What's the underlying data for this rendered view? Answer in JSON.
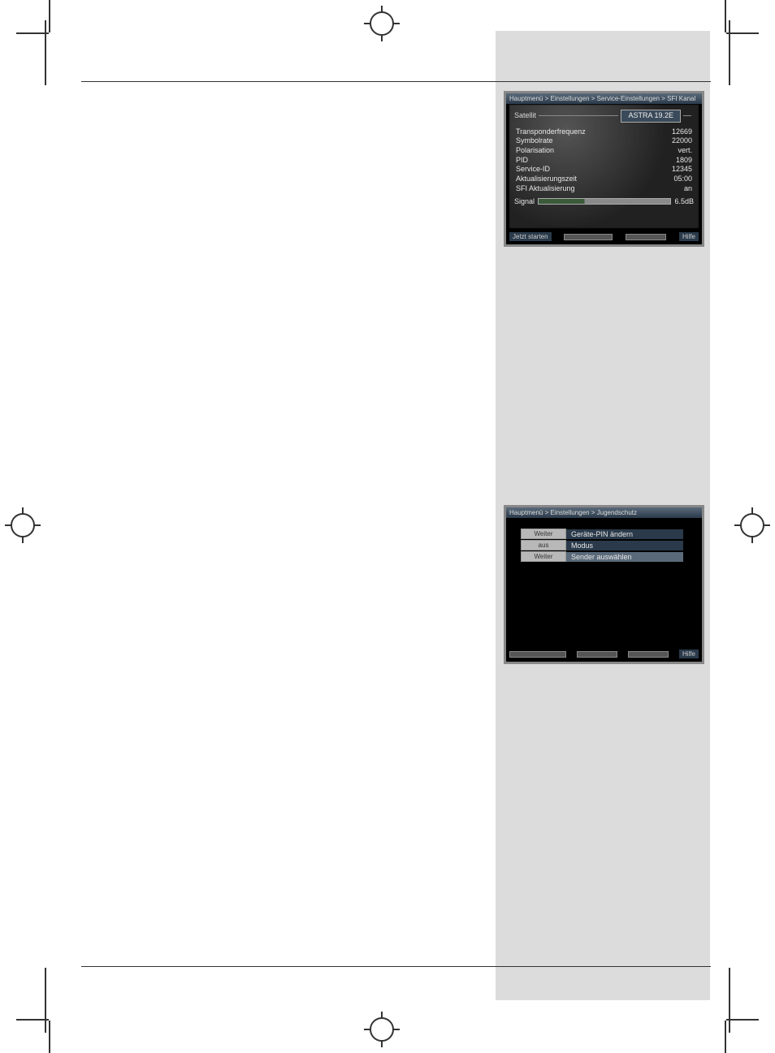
{
  "panel1": {
    "breadcrumb": "Hauptmenü > Einstellungen > Service-Einstellungen > SFI Kanal",
    "satellite_label": "Satellit",
    "satellite_value": "ASTRA 19.2E",
    "rows": [
      {
        "label": "Transponderfrequenz",
        "value": "12669"
      },
      {
        "label": "Symbolrate",
        "value": "22000"
      },
      {
        "label": "Polarisation",
        "value": "vert."
      },
      {
        "label": "PID",
        "value": "1809"
      },
      {
        "label": "Service-ID",
        "value": "12345"
      },
      {
        "label": "Aktualisierungszeit",
        "value": "05:00"
      },
      {
        "label": "SFI Aktualisierung",
        "value": "an"
      }
    ],
    "signal_label": "Signal",
    "signal_value": "6.5dB",
    "footer_left": "Jetzt starten",
    "footer_right": "Hilfe"
  },
  "panel2": {
    "breadcrumb": "Hauptmenü > Einstellungen > Jugendschutz",
    "rows": [
      {
        "left": "Weiter",
        "right": "Geräte-PIN ändern",
        "hl": false
      },
      {
        "left": "aus",
        "right": "Modus",
        "hl": false
      },
      {
        "left": "Weiter",
        "right": "Sender auswählen",
        "hl": true
      }
    ],
    "footer_right": "Hilfe"
  }
}
